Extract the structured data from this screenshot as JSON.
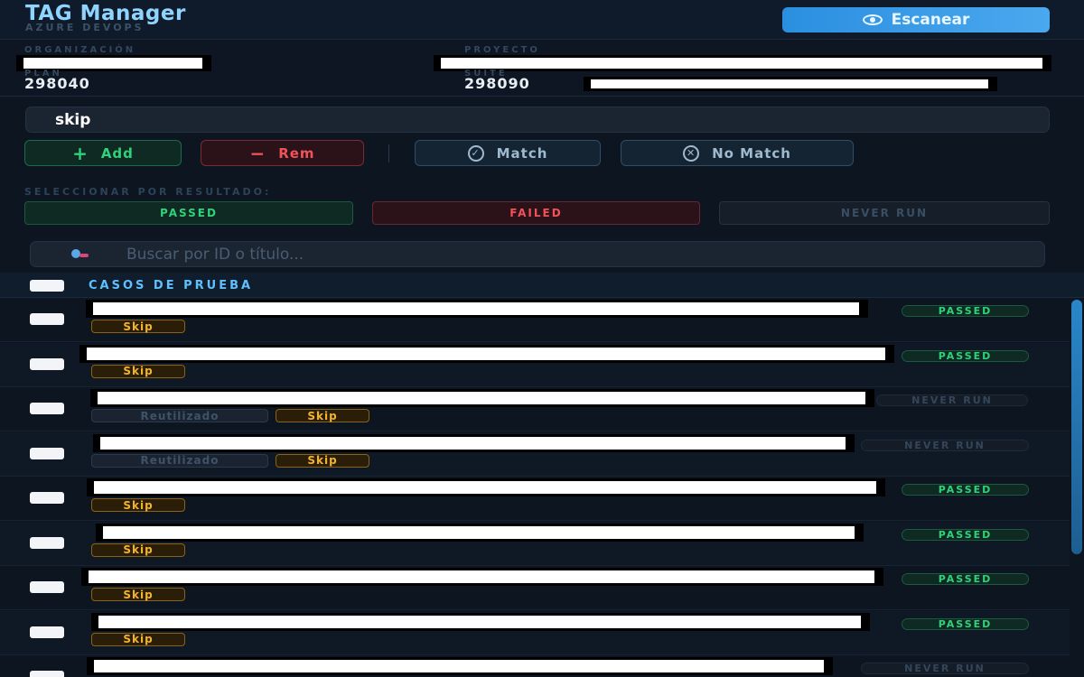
{
  "header": {
    "title": "TAG Manager",
    "subtitle": "AZURE DEVOPS",
    "scan_label": "Escanear",
    "scan_icon": "eye-icon"
  },
  "info": {
    "org_label": "ORGANIZACIÓN",
    "org_value": "",
    "project_label": "PROYECTO",
    "project_value": "",
    "plan_label": "PLAN",
    "plan_value": "298040",
    "suite_label": "SUITE",
    "suite_value": "298090"
  },
  "tag_input": {
    "value": "skip"
  },
  "actions": {
    "add_label": "Add",
    "rem_label": "Rem",
    "match_label": "Match",
    "nomatch_label": "No Match"
  },
  "filter": {
    "section_label": "SELECCIONAR POR RESULTADO:",
    "passed": "PASSED",
    "failed": "FAILED",
    "never_run": "NEVER RUN"
  },
  "search": {
    "placeholder": "Buscar por ID o título..."
  },
  "table": {
    "header": "CASOS DE PRUEBA",
    "rows": [
      {
        "status": "PASSED",
        "tags": [
          "Skip"
        ]
      },
      {
        "status": "PASSED",
        "tags": [
          "Skip"
        ]
      },
      {
        "status": "NEVER RUN",
        "tags": [
          "Reutilizado",
          "Skip"
        ]
      },
      {
        "status": "NEVER RUN",
        "tags": [
          "Reutilizado",
          "Skip"
        ]
      },
      {
        "status": "PASSED",
        "tags": [
          "Skip"
        ]
      },
      {
        "status": "PASSED",
        "tags": [
          "Skip"
        ]
      },
      {
        "status": "PASSED",
        "tags": [
          "Skip"
        ]
      },
      {
        "status": "PASSED",
        "tags": [
          "Skip"
        ]
      },
      {
        "status": "NEVER RUN",
        "tags": []
      }
    ]
  },
  "colors": {
    "accent": "#2b8fe0",
    "passed": "#2fd27a",
    "failed": "#f0525a",
    "skip": "#f3b32b"
  }
}
